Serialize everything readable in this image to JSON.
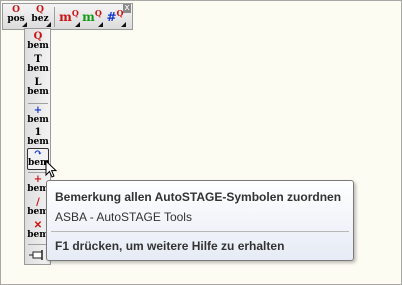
{
  "colors": {
    "background": "#fdfcf3",
    "accent_red": "#cc1111",
    "accent_green": "#119911",
    "accent_blue": "#1133cc"
  },
  "top_toolbar": {
    "buttons": [
      {
        "top": "O",
        "bottom": "pos",
        "name": "Position-Symbol"
      },
      {
        "top": "Q",
        "bottom": "bez",
        "name": "Bezeichnung"
      },
      {
        "main": "m",
        "sup": "Q",
        "name": "Mass rot"
      },
      {
        "main": "m",
        "sup": "Q",
        "name": "Mass gruen"
      },
      {
        "main": "#",
        "sup": "Q",
        "name": "Nummer"
      }
    ],
    "close": "x"
  },
  "side_toolbar": {
    "buttons": [
      {
        "top": "Q",
        "bottom": "bem"
      },
      {
        "top": "T",
        "bottom": "bem"
      },
      {
        "top": "L",
        "bottom": "bem"
      },
      {
        "top": "+",
        "bottom": "bem"
      },
      {
        "top": "1",
        "bottom": "bem"
      },
      {
        "top": "↷",
        "bottom": "bem"
      },
      {
        "top": "+",
        "bottom": "bem"
      },
      {
        "top": "/",
        "bottom": "bem"
      },
      {
        "top": "✕",
        "bottom": "bem"
      }
    ]
  },
  "tooltip": {
    "title": "Bemerkung allen AutoSTAGE-Symbolen zuordnen",
    "subtitle": "ASBA - AutoSTAGE Tools",
    "help": "F1 drücken, um weitere Hilfe zu erhalten"
  }
}
